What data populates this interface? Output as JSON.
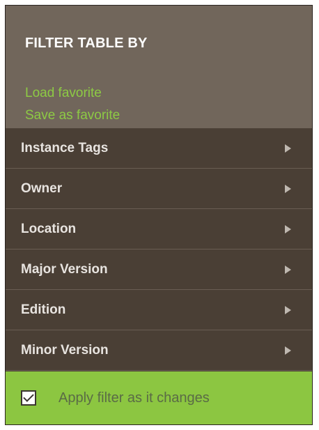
{
  "header": {
    "title": "FILTER TABLE BY",
    "load_favorite": "Load favorite",
    "save_favorite": "Save as favorite"
  },
  "filters": [
    {
      "label": "Instance Tags",
      "icon": "chevron-right-icon"
    },
    {
      "label": "Owner",
      "icon": "chevron-right-icon"
    },
    {
      "label": "Location",
      "icon": "chevron-right-icon"
    },
    {
      "label": "Major Version",
      "icon": "chevron-right-icon"
    },
    {
      "label": "Edition",
      "icon": "chevron-right-icon"
    },
    {
      "label": "Minor Version",
      "icon": "chevron-right-icon"
    }
  ],
  "footer": {
    "apply_label": "Apply filter as it changes",
    "apply_checked": true
  },
  "colors": {
    "header_bg": "#71665b",
    "list_bg": "#4a3f35",
    "accent": "#8dca44",
    "footer_bg": "#8cc641"
  }
}
